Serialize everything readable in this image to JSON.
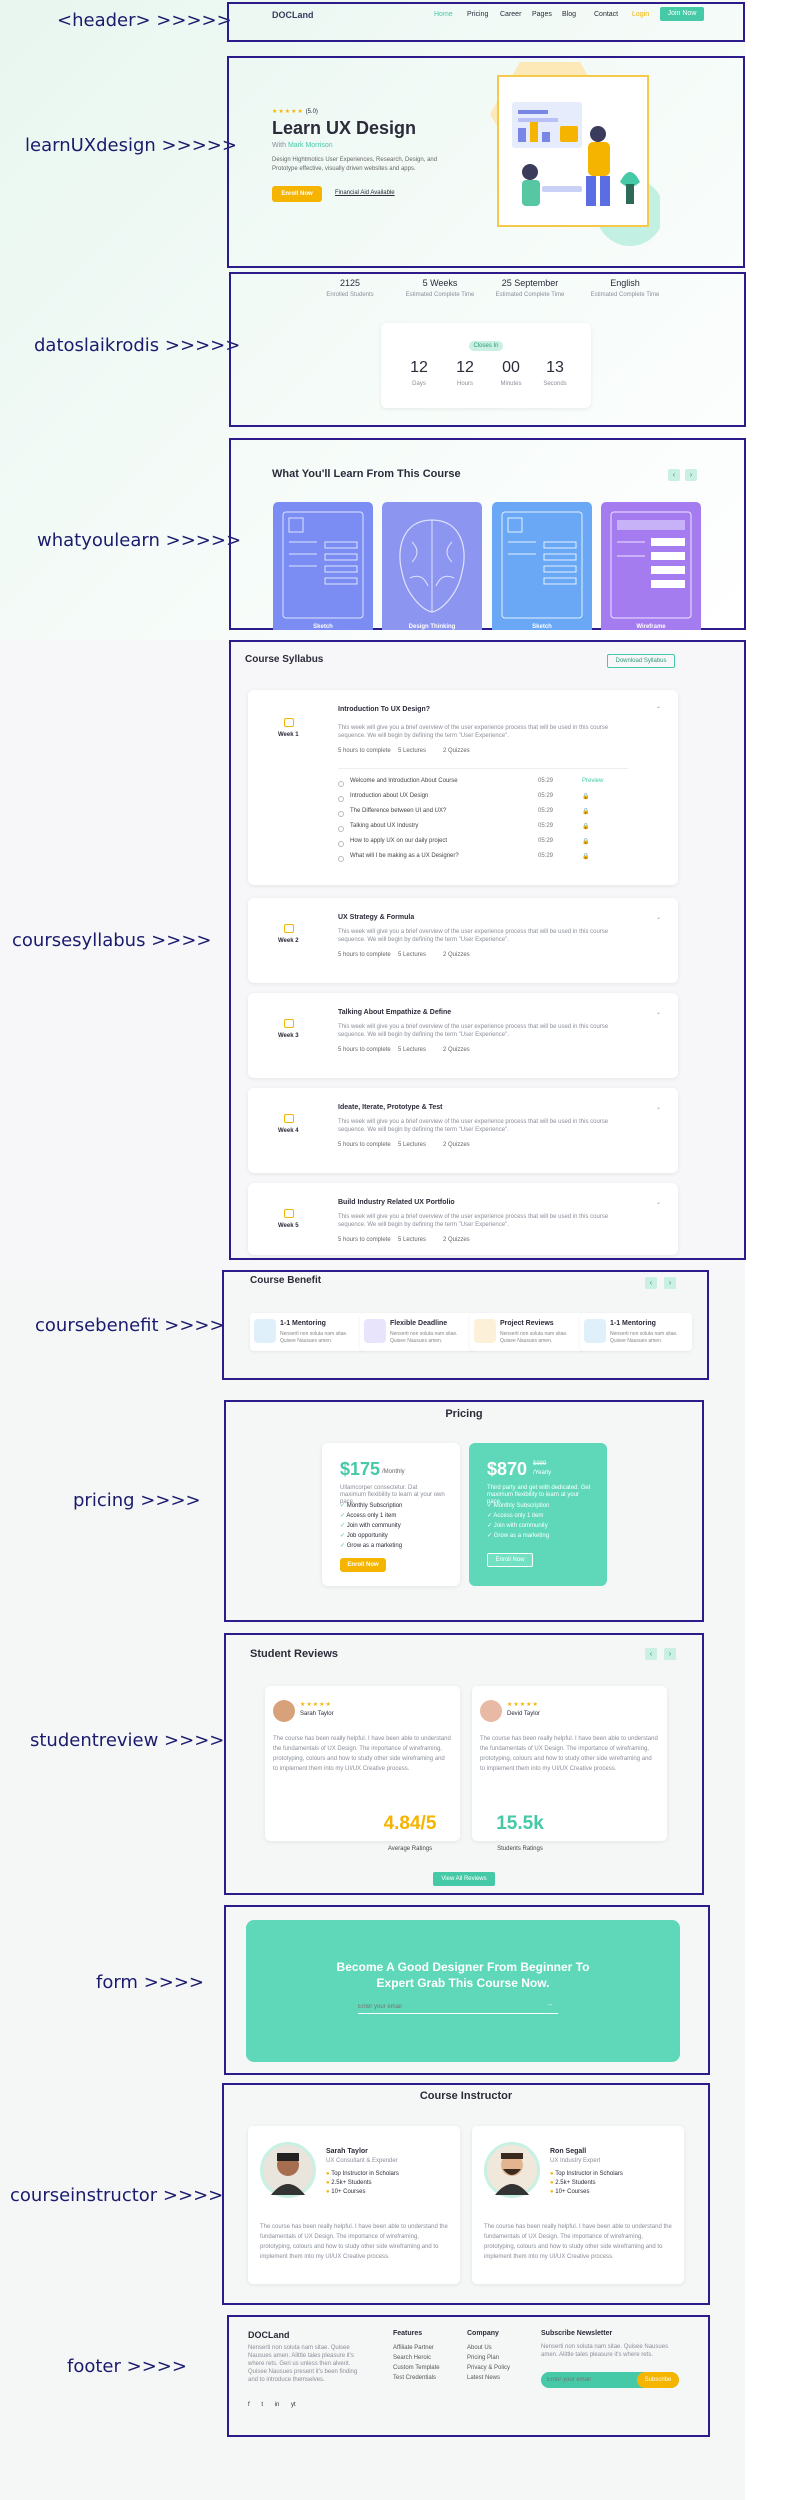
{
  "callouts": {
    "header": "<header>  >>>>>",
    "learn": "learnUXdesign  >>>>>",
    "datos": "datoslaikrodis  >>>>>",
    "what": "whatyoulearn >>>>>",
    "syllabus": "coursesyllabus  >>>>",
    "benefit": "coursebenefit  >>>>",
    "pricing": "pricing >>>>",
    "review": "studentreview >>>>",
    "form": "form  >>>>",
    "instructor": "courseinstructor  >>>>",
    "footer": "footer  >>>>"
  },
  "header": {
    "logo": "DOCLand",
    "nav": [
      "Home",
      "Pricing",
      "Career",
      "Pages",
      "Blog",
      "Contact",
      "Login"
    ],
    "cta": "Join Now"
  },
  "hero": {
    "rating": "★★★★★",
    "rating_value": "(5.0)",
    "title": "Learn UX Design",
    "byline_prefix": "With ",
    "byline_name": "Mark Morrison",
    "description": "Design Hightmotics User Experiences, Research, Design, and Prototype effective, visually driven websites and apps.",
    "enroll": "Enroll Now",
    "financial": "Financial Aid Available"
  },
  "stats": [
    {
      "value": "2125",
      "label": "Enrolled Students"
    },
    {
      "value": "5 Weeks",
      "label": "Estimated Complete Time"
    },
    {
      "value": "25 September",
      "label": "Estimated Complete Time"
    },
    {
      "value": "English",
      "label": "Estimated Complete Time"
    }
  ],
  "countdown": {
    "badge": "Closes In",
    "items": [
      {
        "value": "12",
        "label": "Days"
      },
      {
        "value": "12",
        "label": "Hours"
      },
      {
        "value": "00",
        "label": "Minutes"
      },
      {
        "value": "13",
        "label": "Seconds"
      }
    ]
  },
  "learn": {
    "title": "What You'll Learn From This Course",
    "prev": "‹",
    "next": "›",
    "cards": [
      {
        "label": "Sketch",
        "color": "#7b8cf2"
      },
      {
        "label": "Design Thinking",
        "color": "#8c95f0"
      },
      {
        "label": "Sketch",
        "color": "#6aa8f5"
      },
      {
        "label": "Wireframe",
        "color": "#a47cf0"
      }
    ]
  },
  "syllabus": {
    "title": "Course Syllabus",
    "download": "Download Syllabus",
    "weeks": [
      {
        "week": "Week 1",
        "title": "Introduction To UX Design?",
        "desc": "This week will give you a brief overview of the user experience process that will be used in this course sequence. We will begin by defining the term \"User Experience\".",
        "hours": "5 hours to complete",
        "lectures": "5 Lectures",
        "quizzes": "2 Quizzes"
      },
      {
        "week": "Week 2",
        "title": "UX Strategy & Formula",
        "desc": "This week will give you a brief overview of the user experience process that will be used in this course sequence. We will begin by defining the term \"User Experience\".",
        "hours": "5 hours to complete",
        "lectures": "5 Lectures",
        "quizzes": "2 Quizzes"
      },
      {
        "week": "Week 3",
        "title": "Talking About Empathize & Define",
        "desc": "This week will give you a brief overview of the user experience process that will be used in this course sequence. We will begin by defining the term \"User Experience\".",
        "hours": "5 hours to complete",
        "lectures": "5 Lectures",
        "quizzes": "2 Quizzes"
      },
      {
        "week": "Week 4",
        "title": "Ideate, Iterate, Prototype & Test",
        "desc": "This week will give you a brief overview of the user experience process that will be used in this course sequence. We will begin by defining the term \"User Experience\".",
        "hours": "5 hours to complete",
        "lectures": "5 Lectures",
        "quizzes": "2 Quizzes"
      },
      {
        "week": "Week 5",
        "title": "Build Industry Related UX Portfolio",
        "desc": "This week will give you a brief overview of the user experience process that will be used in this course sequence. We will begin by defining the term \"User Experience\".",
        "hours": "5 hours to complete",
        "lectures": "5 Lectures",
        "quizzes": "2 Quizzes"
      }
    ],
    "lessons": [
      {
        "title": "Welcome and Introduction About Course",
        "duration": "05:29",
        "action": "Preview"
      },
      {
        "title": "Introduction about UX Design",
        "duration": "05:29",
        "action": "🔒"
      },
      {
        "title": "The Difference between UI and UX?",
        "duration": "05:29",
        "action": "🔒"
      },
      {
        "title": "Talking about UX Industry",
        "duration": "05:29",
        "action": "🔒"
      },
      {
        "title": "How to apply UX on our daily project",
        "duration": "05:29",
        "action": "🔒"
      },
      {
        "title": "What will I be making as a UX Designer?",
        "duration": "05:29",
        "action": "🔒"
      }
    ]
  },
  "benefit": {
    "title": "Course Benefit",
    "items": [
      {
        "title": "1-1 Mentoring",
        "desc": "Nenserti non soluta nam sitae. Quisee Nausues amen.",
        "color": "#dff0fb"
      },
      {
        "title": "Flexible Deadline",
        "desc": "Nenserti non soluta nam sitae. Quisee Nausues amen.",
        "color": "#e8e4fb"
      },
      {
        "title": "Project Reviews",
        "desc": "Nenserti non soluta nam sitae. Quisee Nausues amen.",
        "color": "#fdf0d8"
      },
      {
        "title": "1-1 Mentoring",
        "desc": "Nenserti non soluta nam sitae. Quisee Nausues amen.",
        "color": "#dff0fb"
      }
    ]
  },
  "pricing": {
    "title": "Pricing",
    "basic": {
      "price": "$175",
      "period": "/Monthly",
      "desc": "Ullamcorper consectetur. Dat maximum flexibility to learn at your own pace.",
      "features": [
        "Monthly Subscription",
        "Access only 1 item",
        "Join with community",
        "Job opportunity",
        "Grow as a marketing"
      ],
      "button": "Enroll Now"
    },
    "pro": {
      "price": "$870",
      "old": "$999",
      "period": "/Yearly",
      "desc": "Third party and get with dedicated. Get maximum flexibility to learn at your pace.",
      "features": [
        "Monthly Subscription",
        "Access only 1 item",
        "Join with community",
        "Grow as a marketing"
      ],
      "button": "Enroll Now"
    }
  },
  "reviews": {
    "title": "Student Reviews",
    "items": [
      {
        "stars": "★★★★★",
        "name": "Sarah Taylor",
        "text": "The course has been really helpful. I have been able to understand the fundamentals of UX Design. The importance of wireframing, prototyping, colours and how to study other side wireframing and to implement them into my UI/UX Creative process."
      },
      {
        "stars": "★★★★★",
        "name": "Devid Taylor",
        "text": "The course has been really helpful. I have been able to understand the fundamentals of UX Design. The importance of wireframing, prototyping, colours and how to study other side wireframing and to implement them into my UI/UX Creative process."
      }
    ],
    "avg_value": "4.84/5",
    "avg_label": "Average Ratings",
    "count_value": "15.5k",
    "count_label": "Students Ratings",
    "view_all": "View All Reviews"
  },
  "cta": {
    "title_line1": "Become A Good Designer From Beginner To",
    "title_line2": "Expert Grab This Course Now.",
    "placeholder": "Enter your email",
    "arrow": "→"
  },
  "instructors": {
    "title": "Course Instructor",
    "items": [
      {
        "name": "Sarah Taylor",
        "role": "UX Consultant & Expender",
        "meta": [
          "Top Instructor in Scholars",
          "2.5k+ Students",
          "10+ Courses"
        ],
        "bio": "The course has been really helpful. I have been able to understand the fundamentals of UX Design. The importance of wireframing, prototyping, colours and how to study other side wireframing and to implement them into my UI/UX Creative process."
      },
      {
        "name": "Ron Segall",
        "role": "UX Industry Expert",
        "meta": [
          "Top Instructor in Scholars",
          "2.5k+ Students",
          "10+ Courses"
        ],
        "bio": "The course has been really helpful. I have been able to understand the fundamentals of UX Design. The importance of wireframing, prototyping, colours and how to study other side wireframing and to implement them into my UI/UX Creative process."
      }
    ]
  },
  "footer": {
    "logo": "DOCLand",
    "about": "Nenserti non soluta nam sitae. Quisee Nausues amen. Alittle tales pleasure it's where rets. Geri us unless then alvent. Quisee Nausues present it's been finding and to introduce themselves.",
    "social": [
      "f",
      "t",
      "in",
      "yt"
    ],
    "features_title": "Features",
    "features": [
      "Affiliate Partner",
      "Search Heroic",
      "Custom Template",
      "Test Credentials"
    ],
    "company_title": "Company",
    "company": [
      "About Us",
      "Pricing Plan",
      "Privacy & Policy",
      "Latest News"
    ],
    "newsletter_title": "Subscribe Newsletter",
    "newsletter_desc": "Nenserti non soluta nam sitae. Quisee Nausues amen. Alittle tales pleasure it's where rets.",
    "email_placeholder": "Enter your email",
    "subscribe": "Subscribe"
  }
}
